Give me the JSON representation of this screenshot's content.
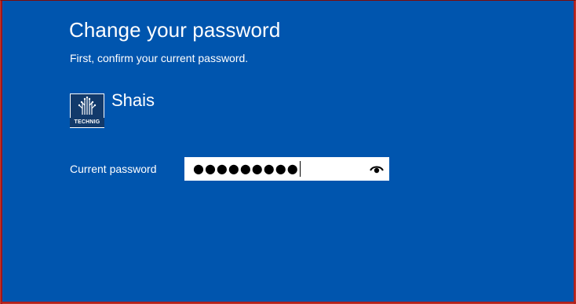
{
  "dialog": {
    "title": "Change your password",
    "subtitle": "First, confirm your current password."
  },
  "account": {
    "username": "Shais",
    "avatar_text": "TECHNIG",
    "avatar_icon": "technig-logo-icon"
  },
  "form": {
    "current_password_label": "Current password",
    "current_password_value": "●●●●●●●●●",
    "reveal_icon": "eye-icon"
  },
  "colors": {
    "background": "#0055ae",
    "text": "#ffffff",
    "input_background": "#ffffff"
  }
}
